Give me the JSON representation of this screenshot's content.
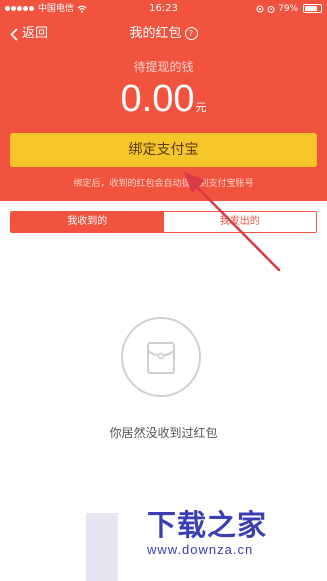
{
  "status_bar": {
    "carrier": "中国电信",
    "time": "16:23",
    "battery_percent": "79%",
    "battery_level": 0.79
  },
  "nav": {
    "back_label": "返回",
    "title": "我的红包",
    "help_glyph": "?"
  },
  "balance": {
    "label": "待提现的钱",
    "amount": "0.00",
    "unit": "元"
  },
  "bind_button_label": "绑定支付宝",
  "hint_text": "绑定后，收到的红包会自动提现到支付宝账号",
  "tabs": [
    {
      "label": "我收到的",
      "active": true
    },
    {
      "label": "我发出的",
      "active": false
    }
  ],
  "empty_state": {
    "icon": "red-envelope-icon",
    "text": "你居然没收到过红包"
  },
  "watermark": {
    "main": "下载之家",
    "sub": "www.downza.cn"
  },
  "colors": {
    "header_bg": "#f2533e",
    "button_bg": "#f6c629",
    "annotation_arrow": "#d83a46",
    "watermark": "#3a3fb3"
  }
}
